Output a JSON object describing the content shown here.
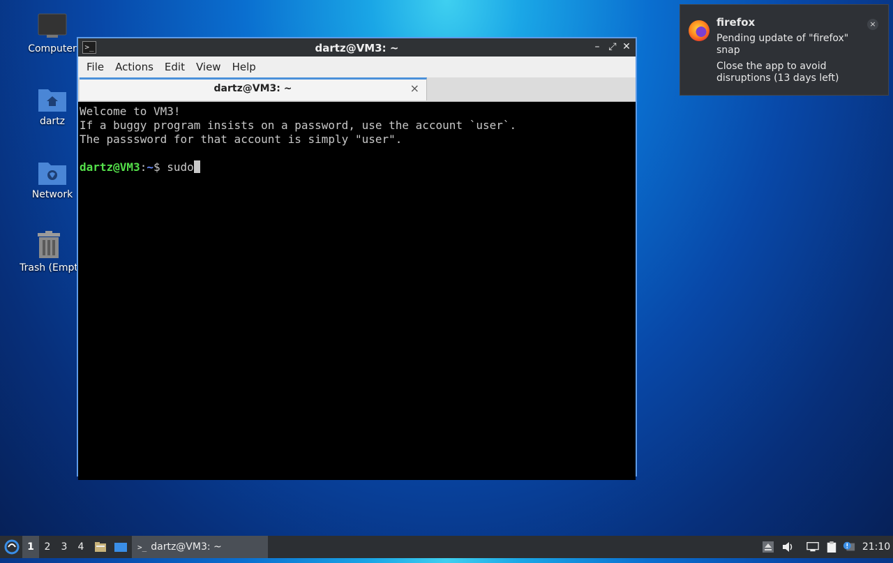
{
  "desktop": {
    "icons": [
      {
        "label": "Computer"
      },
      {
        "label": "dartz"
      },
      {
        "label": "Network"
      },
      {
        "label": "Trash (Empt"
      }
    ]
  },
  "window": {
    "title": "dartz@VM3: ~",
    "menu": [
      "File",
      "Actions",
      "Edit",
      "View",
      "Help"
    ],
    "tab": {
      "label": "dartz@VM3: ~",
      "close": "×"
    },
    "terminal": {
      "lines": [
        "Welcome to VM3!",
        "If a buggy program insists on a password, use the account `user`.",
        "The passsword for that account is simply \"user\"."
      ],
      "prompt_user": "dartz@VM3",
      "prompt_sep": ":",
      "prompt_path": "~",
      "prompt_symbol": "$ ",
      "command": "sudo"
    }
  },
  "notification": {
    "app": "firefox",
    "body": "Pending update of \"firefox\" snap",
    "body2": "Close the app to avoid disruptions (13 days left)",
    "close": "×"
  },
  "taskbar": {
    "workspaces": [
      "1",
      "2",
      "3",
      "4"
    ],
    "active_workspace": "1",
    "task_label": "dartz@VM3: ~",
    "clock": "21:10"
  },
  "colors": {
    "accent": "#4a90d9",
    "prompt_user": "#54e04a",
    "prompt_path": "#6a8dff"
  }
}
